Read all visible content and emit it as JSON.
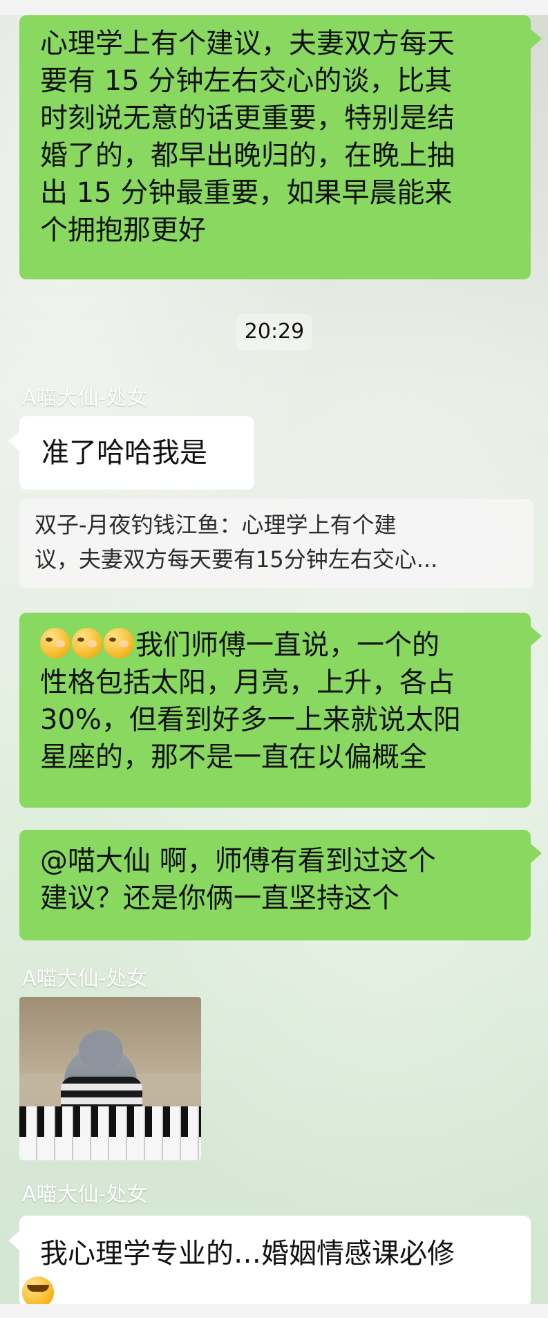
{
  "timestamp": "20:29",
  "messages": {
    "first": {
      "lines": [
        "心理学上有个建议，夫妻双方每天",
        "要有 15 分钟左右交心的谈，比其",
        "时刻说无意的话更重要，特别是结",
        "婚了的，都早出晚归的，在晚上抽",
        "出 15 分钟最重要，如果早晨能来",
        "个拥抱那更好"
      ]
    },
    "sender1": "A喵大仙-处女",
    "reply1": "准了哈哈我是",
    "quote": {
      "line1": "双子-月夜钓钱江鱼：心理学上有个建",
      "line2": "议，夫妻双方每天要有15分钟左右交心..."
    },
    "second": {
      "line1_text": "我们师傅一直说，一个的",
      "lines": [
        "性格包括太阳，月亮，上升，各占",
        "30%，但看到好多一上来就说太阳",
        "星座的，那不是一直在以偏概全"
      ]
    },
    "third": {
      "lines": [
        "@喵大仙  啊，师傅有看到过这个",
        "建议？还是你俩一直坚持这个"
      ]
    },
    "sender2": "A喵大仙-处女",
    "sender3": "A喵大仙-处女",
    "final": {
      "line1": "我心理学专业的…婚姻情感课必修"
    }
  },
  "icons": {
    "emoji": "facepalm-emoji-icon",
    "laugh": "tears-of-joy-icon"
  }
}
